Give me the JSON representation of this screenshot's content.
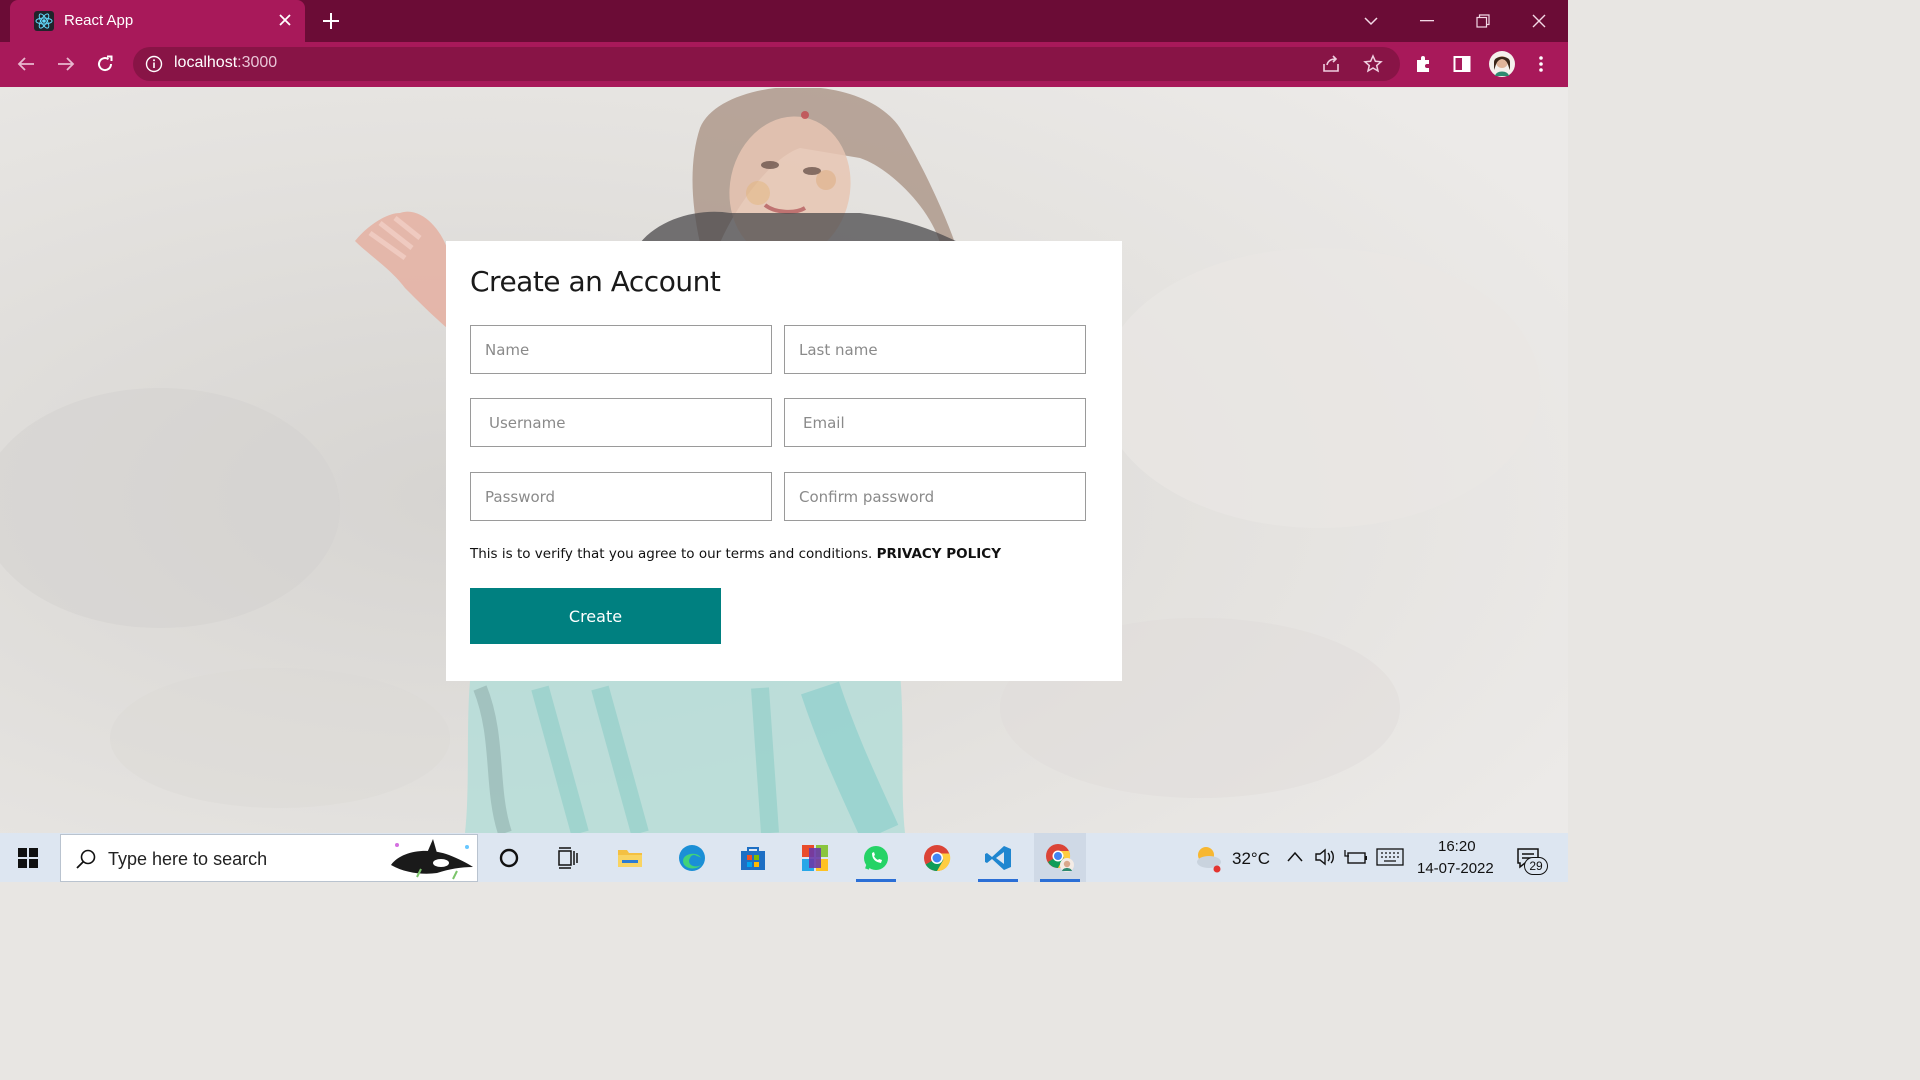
{
  "browser": {
    "tab_title": "React App",
    "url_host": "localhost",
    "url_port": ":3000"
  },
  "form": {
    "title": "Create an Account",
    "fields": {
      "name": "Name",
      "last_name": "Last name",
      "username": "Username",
      "email": "Email",
      "password": "Password",
      "confirm_password": "Confirm password"
    },
    "agree_text": "This is to verify that you agree to our terms and conditions.",
    "privacy_link": "PRIVACY POLICY",
    "submit_label": "Create"
  },
  "taskbar": {
    "search_placeholder": "Type here to search",
    "weather": "32°C",
    "time": "16:20",
    "date": "14-07-2022",
    "notifications": "29"
  },
  "colors": {
    "browser_frame": "#6b0c36",
    "browser_toolbar": "#a8195a",
    "create_button": "#008080"
  }
}
